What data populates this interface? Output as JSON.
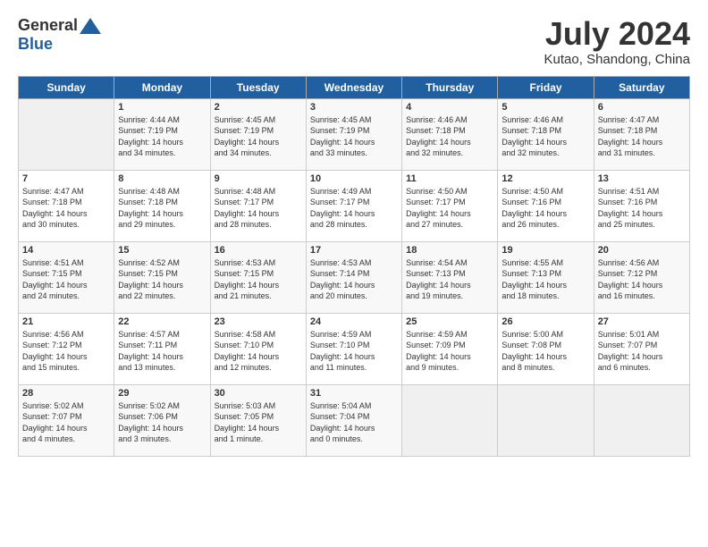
{
  "header": {
    "logo_general": "General",
    "logo_blue": "Blue",
    "month_title": "July 2024",
    "location": "Kutao, Shandong, China"
  },
  "weekdays": [
    "Sunday",
    "Monday",
    "Tuesday",
    "Wednesday",
    "Thursday",
    "Friday",
    "Saturday"
  ],
  "weeks": [
    [
      {
        "day": "",
        "info": ""
      },
      {
        "day": "1",
        "info": "Sunrise: 4:44 AM\nSunset: 7:19 PM\nDaylight: 14 hours\nand 34 minutes."
      },
      {
        "day": "2",
        "info": "Sunrise: 4:45 AM\nSunset: 7:19 PM\nDaylight: 14 hours\nand 34 minutes."
      },
      {
        "day": "3",
        "info": "Sunrise: 4:45 AM\nSunset: 7:19 PM\nDaylight: 14 hours\nand 33 minutes."
      },
      {
        "day": "4",
        "info": "Sunrise: 4:46 AM\nSunset: 7:18 PM\nDaylight: 14 hours\nand 32 minutes."
      },
      {
        "day": "5",
        "info": "Sunrise: 4:46 AM\nSunset: 7:18 PM\nDaylight: 14 hours\nand 32 minutes."
      },
      {
        "day": "6",
        "info": "Sunrise: 4:47 AM\nSunset: 7:18 PM\nDaylight: 14 hours\nand 31 minutes."
      }
    ],
    [
      {
        "day": "7",
        "info": "Sunrise: 4:47 AM\nSunset: 7:18 PM\nDaylight: 14 hours\nand 30 minutes."
      },
      {
        "day": "8",
        "info": "Sunrise: 4:48 AM\nSunset: 7:18 PM\nDaylight: 14 hours\nand 29 minutes."
      },
      {
        "day": "9",
        "info": "Sunrise: 4:48 AM\nSunset: 7:17 PM\nDaylight: 14 hours\nand 28 minutes."
      },
      {
        "day": "10",
        "info": "Sunrise: 4:49 AM\nSunset: 7:17 PM\nDaylight: 14 hours\nand 28 minutes."
      },
      {
        "day": "11",
        "info": "Sunrise: 4:50 AM\nSunset: 7:17 PM\nDaylight: 14 hours\nand 27 minutes."
      },
      {
        "day": "12",
        "info": "Sunrise: 4:50 AM\nSunset: 7:16 PM\nDaylight: 14 hours\nand 26 minutes."
      },
      {
        "day": "13",
        "info": "Sunrise: 4:51 AM\nSunset: 7:16 PM\nDaylight: 14 hours\nand 25 minutes."
      }
    ],
    [
      {
        "day": "14",
        "info": "Sunrise: 4:51 AM\nSunset: 7:15 PM\nDaylight: 14 hours\nand 24 minutes."
      },
      {
        "day": "15",
        "info": "Sunrise: 4:52 AM\nSunset: 7:15 PM\nDaylight: 14 hours\nand 22 minutes."
      },
      {
        "day": "16",
        "info": "Sunrise: 4:53 AM\nSunset: 7:15 PM\nDaylight: 14 hours\nand 21 minutes."
      },
      {
        "day": "17",
        "info": "Sunrise: 4:53 AM\nSunset: 7:14 PM\nDaylight: 14 hours\nand 20 minutes."
      },
      {
        "day": "18",
        "info": "Sunrise: 4:54 AM\nSunset: 7:13 PM\nDaylight: 14 hours\nand 19 minutes."
      },
      {
        "day": "19",
        "info": "Sunrise: 4:55 AM\nSunset: 7:13 PM\nDaylight: 14 hours\nand 18 minutes."
      },
      {
        "day": "20",
        "info": "Sunrise: 4:56 AM\nSunset: 7:12 PM\nDaylight: 14 hours\nand 16 minutes."
      }
    ],
    [
      {
        "day": "21",
        "info": "Sunrise: 4:56 AM\nSunset: 7:12 PM\nDaylight: 14 hours\nand 15 minutes."
      },
      {
        "day": "22",
        "info": "Sunrise: 4:57 AM\nSunset: 7:11 PM\nDaylight: 14 hours\nand 13 minutes."
      },
      {
        "day": "23",
        "info": "Sunrise: 4:58 AM\nSunset: 7:10 PM\nDaylight: 14 hours\nand 12 minutes."
      },
      {
        "day": "24",
        "info": "Sunrise: 4:59 AM\nSunset: 7:10 PM\nDaylight: 14 hours\nand 11 minutes."
      },
      {
        "day": "25",
        "info": "Sunrise: 4:59 AM\nSunset: 7:09 PM\nDaylight: 14 hours\nand 9 minutes."
      },
      {
        "day": "26",
        "info": "Sunrise: 5:00 AM\nSunset: 7:08 PM\nDaylight: 14 hours\nand 8 minutes."
      },
      {
        "day": "27",
        "info": "Sunrise: 5:01 AM\nSunset: 7:07 PM\nDaylight: 14 hours\nand 6 minutes."
      }
    ],
    [
      {
        "day": "28",
        "info": "Sunrise: 5:02 AM\nSunset: 7:07 PM\nDaylight: 14 hours\nand 4 minutes."
      },
      {
        "day": "29",
        "info": "Sunrise: 5:02 AM\nSunset: 7:06 PM\nDaylight: 14 hours\nand 3 minutes."
      },
      {
        "day": "30",
        "info": "Sunrise: 5:03 AM\nSunset: 7:05 PM\nDaylight: 14 hours\nand 1 minute."
      },
      {
        "day": "31",
        "info": "Sunrise: 5:04 AM\nSunset: 7:04 PM\nDaylight: 14 hours\nand 0 minutes."
      },
      {
        "day": "",
        "info": ""
      },
      {
        "day": "",
        "info": ""
      },
      {
        "day": "",
        "info": ""
      }
    ]
  ]
}
